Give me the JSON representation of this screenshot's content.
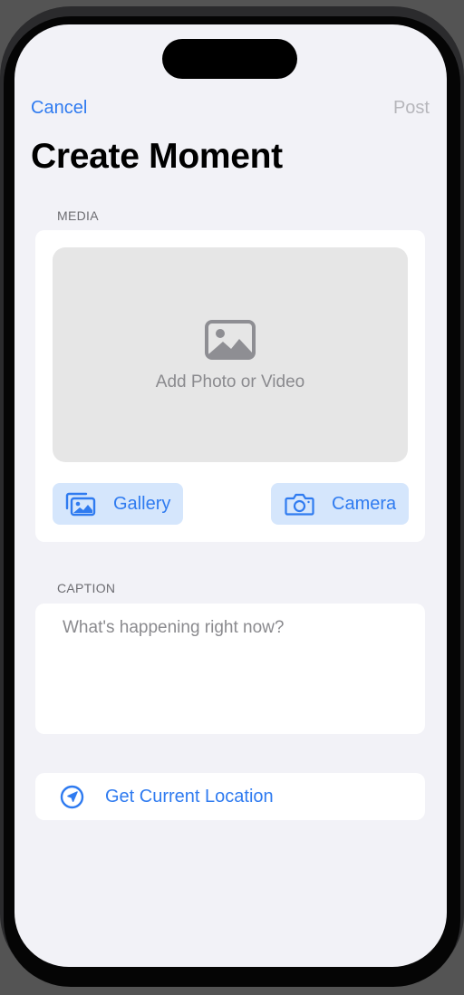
{
  "nav": {
    "cancel_label": "Cancel",
    "post_label": "Post"
  },
  "page": {
    "title": "Create Moment"
  },
  "media": {
    "section_label": "MEDIA",
    "placeholder_text": "Add Photo or Video",
    "placeholder_icon": "photo-icon",
    "gallery_label": "Gallery",
    "gallery_icon": "photo-stack-icon",
    "camera_label": "Camera",
    "camera_icon": "camera-icon"
  },
  "caption": {
    "section_label": "CAPTION",
    "placeholder": "What's happening right now?"
  },
  "location": {
    "button_label": "Get Current Location",
    "icon": "location-arrow-icon"
  },
  "colors": {
    "accent": "#2f7bf0",
    "background": "#f2f2f7",
    "pill_background": "#d5e6fc",
    "disabled": "#b6b6bb"
  }
}
